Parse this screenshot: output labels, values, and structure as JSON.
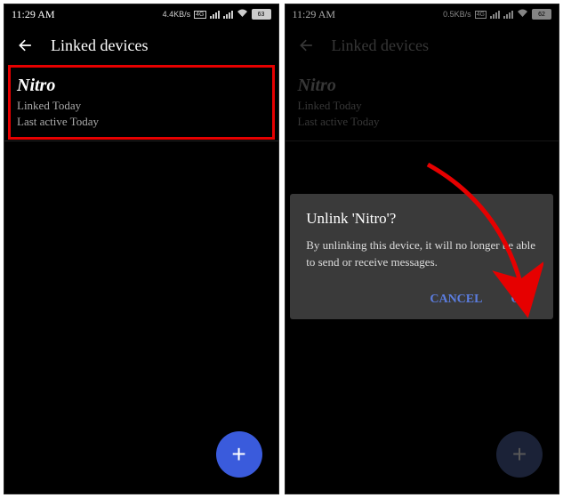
{
  "status": {
    "time": "11:29 AM",
    "speed_left": "4.4KB/s",
    "speed_right": "0.5KB/s",
    "net_badge": "4G",
    "battery_left": "63",
    "battery_right": "62"
  },
  "header": {
    "title": "Linked devices"
  },
  "device": {
    "name": "Nitro",
    "linked": "Linked Today",
    "active": "Last active Today"
  },
  "dialog": {
    "title": "Unlink 'Nitro'?",
    "body": "By unlinking this device, it will no longer be able to send or receive messages.",
    "cancel": "CANCEL",
    "ok": "OK"
  },
  "fab": {
    "plus": "+"
  }
}
